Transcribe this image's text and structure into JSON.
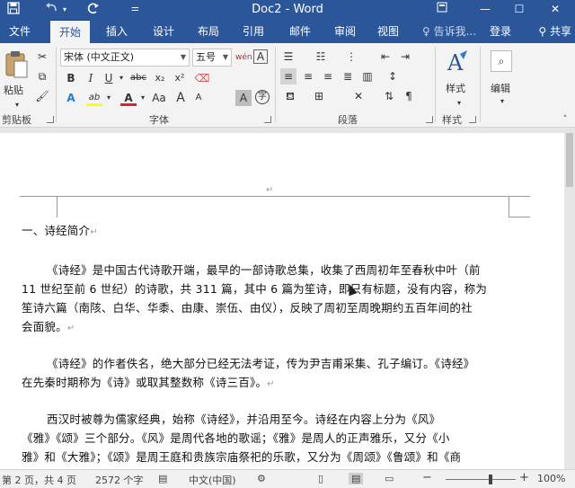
{
  "titlebar": {
    "title": "Doc2 - Word",
    "save_icon": "save-icon",
    "undo_icon": "undo-icon",
    "redo_icon": "redo-icon",
    "customize_icon": "customize-icon",
    "ribbon_display_icon": "ribbon-display-icon",
    "minimize": "—",
    "maximize": "☐",
    "close": "✕"
  },
  "tabs": [
    {
      "label": "文件"
    },
    {
      "label": "开始"
    },
    {
      "label": "插入"
    },
    {
      "label": "设计"
    },
    {
      "label": "布局"
    },
    {
      "label": "引用"
    },
    {
      "label": "邮件"
    },
    {
      "label": "审阅"
    },
    {
      "label": "视图"
    }
  ],
  "tell_me": "告诉我...",
  "login": "登录",
  "share": "共享",
  "ribbon": {
    "clipboard": {
      "paste_label": "粘贴",
      "group_label": "剪贴板"
    },
    "font": {
      "font_name": "宋体 (中文正文)",
      "font_size": "五号",
      "wen_icon": "wén",
      "bold": "B",
      "italic": "I",
      "underline": "U",
      "strike": "abc",
      "subscript": "x₂",
      "superscript": "x²",
      "text_effect": "A",
      "highlight": "ab",
      "font_color": "A",
      "change_case": "Aa",
      "grow": "A",
      "shrink": "A",
      "char_shading": "A",
      "enclose": "字",
      "group_label": "字体"
    },
    "paragraph": {
      "group_label": "段落"
    },
    "styles": {
      "label": "样式",
      "group_label": "样式"
    },
    "editing": {
      "label": "编辑"
    }
  },
  "document": {
    "heading": "一、诗经简介",
    "p1": [
      "《诗经》是中国古代诗歌开端，最早的一部诗歌总集，收集了西周初年至春秋中叶（前",
      "11 世纪至前 6 世纪）的诗歌，共 311 篇，其中 6 篇为笙诗，即只有标题，没有内容，称为",
      "笙诗六篇（南陔、白华、华黍、由康、崇伍、由仪），反映了周初至周晚期约五百年间的社",
      "会面貌。"
    ],
    "p2": [
      "《诗经》的作者佚名，绝大部分已经无法考证，传为尹吉甫采集、孔子编订。《诗经》",
      "在先秦时期称为《诗》或取其整数称《诗三百》。"
    ],
    "p3": [
      "西汉时被尊为儒家经典，始称《诗经》，并沿用至今。诗经在内容上分为《风》",
      "《雅》《颂》三个部分。《风》是周代各地的歌谣；《雅》是周人的正声雅乐，又分《小",
      "雅》和《大雅》；《颂》是周王庭和贵族宗庙祭祀的乐歌，又分为《周颂》《鲁颂》和《商"
    ],
    "para_mark": "↵"
  },
  "status": {
    "page": "第 2 页，共 4 页",
    "words": "2572 个字",
    "language": "中文(中国)",
    "zoom": "100%",
    "zoom_minus": "−",
    "zoom_plus": "+"
  }
}
